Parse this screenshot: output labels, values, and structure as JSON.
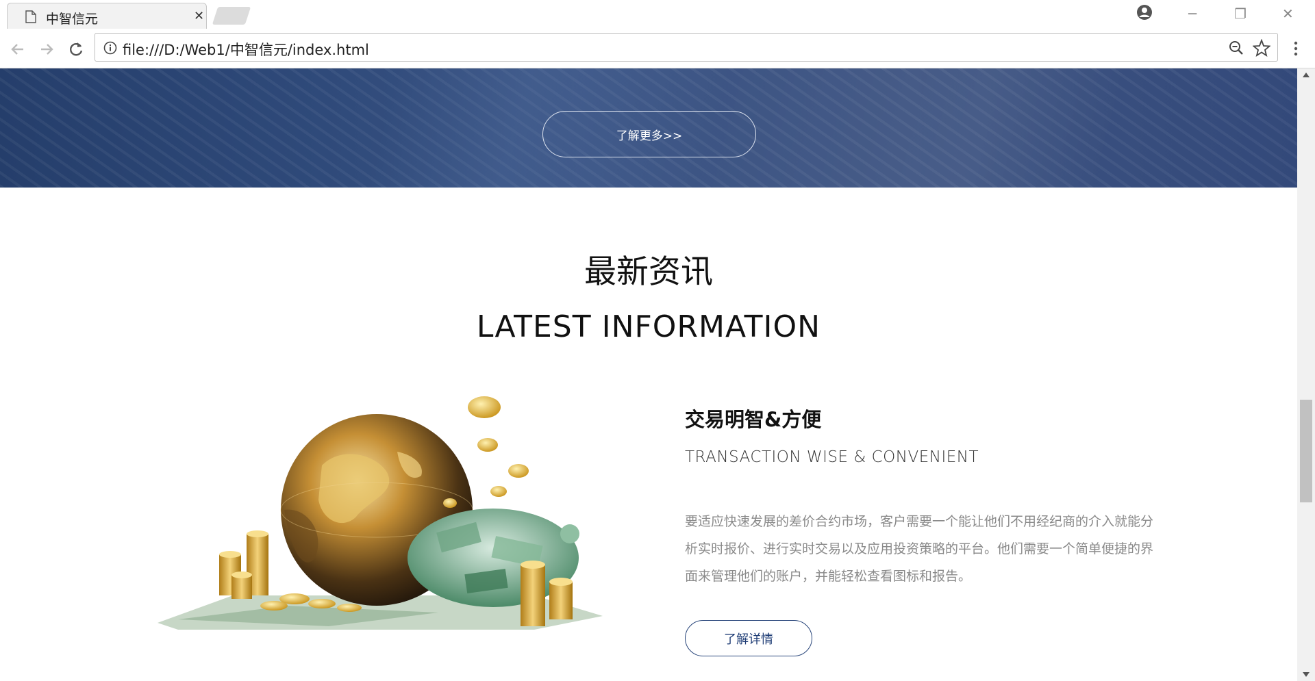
{
  "browser": {
    "tab_title": "中智信元",
    "url": "file:///D:/Web1/中智信元/index.html"
  },
  "banner": {
    "button_label": "了解更多>>"
  },
  "news": {
    "title_cn": "最新资讯",
    "title_en": "LATEST INFORMATION",
    "item": {
      "heading": "交易明智&方便",
      "subheading": "TRANSACTION WISE & CONVENIENT",
      "description": "要适应快速发展的差价合约市场，客户需要一个能让他们不用经纪商的介入就能分析实时报价、进行实时交易以及应用投资策略的平台。他们需要一个简单便捷的界面来管理他们的账户，并能轻松查看图标和报告。",
      "button_label": "了解详情"
    }
  },
  "colors": {
    "banner_blue": "#2f4a7a",
    "button_navy": "#1d3b74",
    "description_gray": "#8a8a8a"
  }
}
